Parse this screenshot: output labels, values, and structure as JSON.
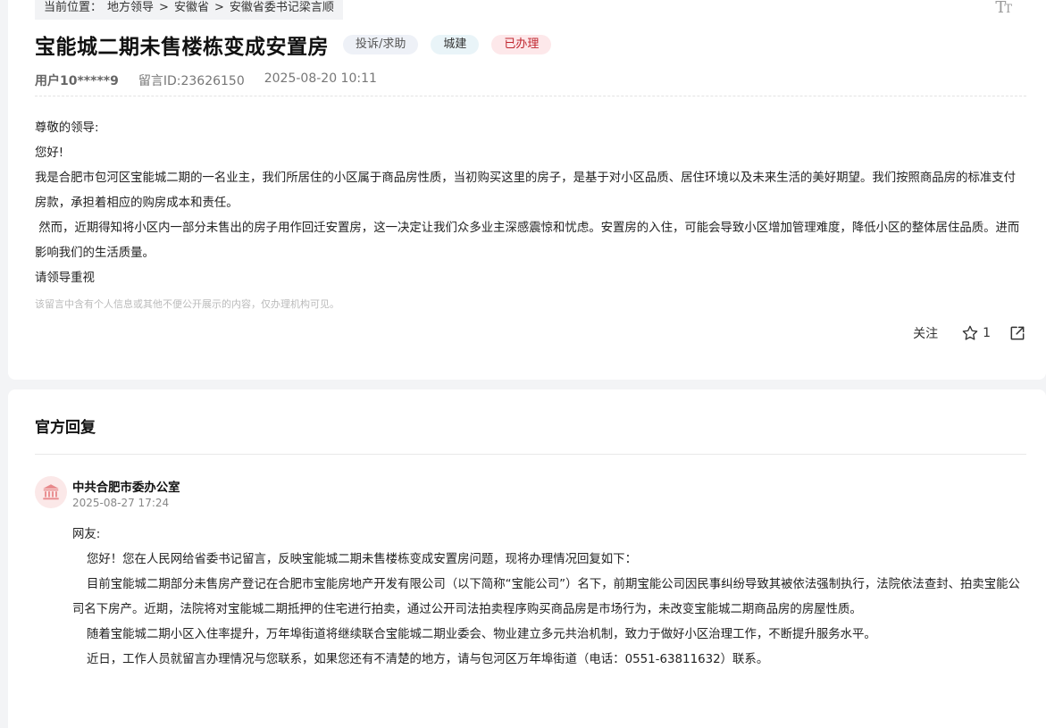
{
  "breadcrumb": {
    "prefix": "当前位置：",
    "items": [
      "地方领导",
      "安徽省",
      "安徽省委书记梁言顺"
    ],
    "separator": ">"
  },
  "font_size_toggle": {
    "icon": "font-size-icon",
    "label_big": "T",
    "label_small": "T"
  },
  "post": {
    "title": "宝能城二期未售楼栋变成安置房",
    "tags": {
      "type": "投诉/求助",
      "field": "城建",
      "status": "已办理"
    },
    "user": "用户10*****9",
    "message_id": "留言ID:23626150",
    "datetime": "2025-08-20 10:11",
    "body": [
      "尊敬的领导:",
      "您好!",
      "我是合肥市包河区宝能城二期的一名业主，我们所居住的小区属于商品房性质，当初购买这里的房子，是基于对小区品质、居住环境以及未来生活的美好期望。我们按照商品房的标准支付房款，承担着相应的购房成本和责任。",
      " 然而，近期得知将小区内一部分未售出的房子用作回迁安置房，这一决定让我们众多业主深感震惊和忧虑。安置房的入住，可能会导致小区增加管理难度，降低小区的整体居住品质。进而影响我们的生活质量。",
      "请领导重视"
    ],
    "notice": "该留言中含有个人信息或其他不便公开展示的内容，仅办理机构可见。",
    "actions": {
      "follow": "关注",
      "star_count": "1"
    }
  },
  "reply": {
    "heading": "官方回复",
    "office": "中共合肥市委办公室",
    "datetime": "2025-08-27 17:24",
    "salutation": "网友:",
    "paragraphs": [
      "您好！您在人民网给省委书记留言，反映宝能城二期未售楼栋变成安置房问题，现将办理情况回复如下：",
      "目前宝能城二期部分未售房产登记在合肥市宝能房地产开发有限公司（以下简称“宝能公司”）名下，前期宝能公司因民事纠纷导致其被依法强制执行，法院依法查封、拍卖宝能公司名下房产。近期，法院将对宝能城二期抵押的住宅进行拍卖，通过公开司法拍卖程序购买商品房是市场行为，未改变宝能城二期商品房的房屋性质。",
      "随着宝能城二期小区入住率提升，万年埠街道将继续联合宝能城二期业委会、物业建立多元共治机制，致力于做好小区治理工作，不断提升服务水平。",
      "近日，工作人员就留言办理情况与您联系，如果您还有不清楚的地方，请与包河区万年埠街道（电话：0551-63811632）联系。"
    ]
  },
  "colors": {
    "status_red": "#c0262f",
    "tag_bg_gray": "#eef1f7",
    "tag_bg_blue": "#e9f4f8",
    "tag_bg_pink": "#fde8ea"
  }
}
